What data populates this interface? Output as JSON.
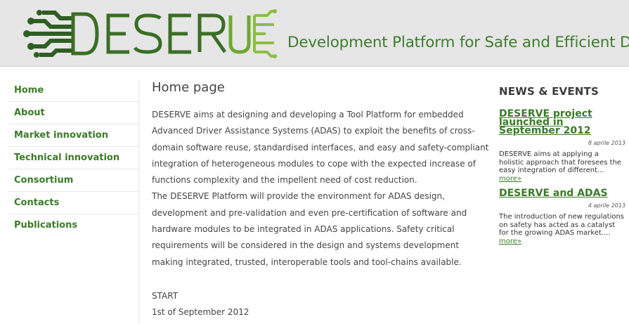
{
  "header": {
    "logo_text": "DESERVE",
    "tagline": "Development Platform for Safe and Efficient Drive"
  },
  "sidebar": {
    "items": [
      {
        "label": "Home"
      },
      {
        "label": "About"
      },
      {
        "label": "Market innovation"
      },
      {
        "label": "Technical innovation"
      },
      {
        "label": "Consortium"
      },
      {
        "label": "Contacts"
      },
      {
        "label": "Publications"
      }
    ]
  },
  "main": {
    "title": "Home page",
    "paragraph1": "DESERVE aims at designing and developing a Tool Platform for embedded Advanced Driver Assistance Systems (ADAS) to exploit the benefits of cross-domain software reuse, standardised interfaces, and easy and safety-compliant integration of heterogeneous modules to cope with the expected increase of functions complexity and the impellent need of cost reduction.",
    "paragraph2": "The DESERVE Platform will provide the environment for ADAS design, development and pre-validation and even pre-certification of software and hardware modules to be integrated in ADAS applications. Safety critical requirements will be considered in the design and systems development making integrated, trusted, interoperable tools and tool-chains available.",
    "start_label": "START",
    "start_date": "1st of September 2012"
  },
  "news": {
    "heading": "NEWS & EVENTS",
    "items": [
      {
        "title": "DESERVE project launched in September 2012",
        "date": "8 aprile 2013",
        "text": "DESERVE aims at applying a holistic approach that foresees the easy integration of different...",
        "more": "more»"
      },
      {
        "title": "DESERVE and ADAS",
        "date": "4 aprile 2013",
        "text": "The introduction of new regulations on safety has acted as a catalyst for the growing ADAS market....",
        "more": "more»"
      }
    ]
  },
  "colors": {
    "brand_green": "#3a7b26",
    "logo_dark_green": "#2f5e22",
    "logo_light_green": "#8cbf3f",
    "header_bg": "#e6e6e6"
  }
}
